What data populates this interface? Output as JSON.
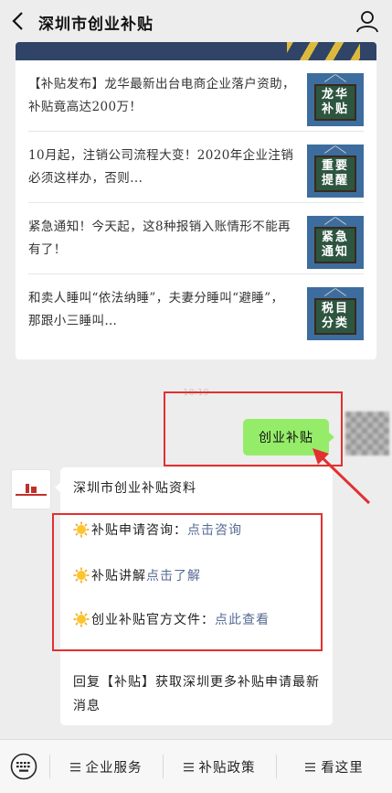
{
  "header": {
    "title": "深圳市创业补贴"
  },
  "articles": [
    {
      "text": "【补贴发布】龙华最新出台电商企业落户资助，补贴竟高达200万！",
      "thumb_label": "龙华\n补贴"
    },
    {
      "text": "10月起，注销公司流程大变！2020年企业注销必须这样办，否则...",
      "thumb_label": "重要\n提醒"
    },
    {
      "text": "紧急通知！今天起，这8种报销入账情形不能再有了！",
      "thumb_label": "紧急\n通知"
    },
    {
      "text": "和卖人睡叫“依法纳睡”，夫妻分睡叫“避睡”，那跟小三睡叫…",
      "thumb_label": "税目\n分类"
    }
  ],
  "timestamp": "18:19",
  "user_message": "创业补贴",
  "bot_message": {
    "title": "深圳市创业补贴资料",
    "lines": [
      {
        "prefix": "补贴申请咨询：",
        "link": "点击咨询"
      },
      {
        "prefix": "补贴讲解",
        "link": "点击了解"
      },
      {
        "prefix": "创业补贴官方文件：",
        "link": "点此查看"
      }
    ],
    "footer": "回复【补贴】获取深圳更多补贴申请最新消息"
  },
  "bottom_menu": {
    "items": [
      "企业服务",
      "补贴政策",
      "看这里"
    ]
  },
  "colors": {
    "user_bubble": "#95ec69",
    "link": "#576b95",
    "annotation_red": "#e23030",
    "thumb_blue": "#3d6d9e"
  }
}
